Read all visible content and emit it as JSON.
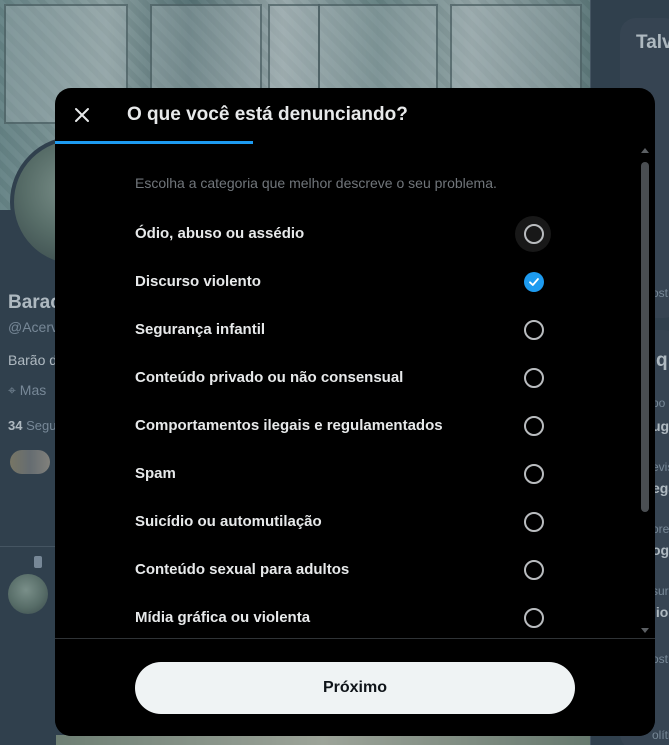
{
  "background": {
    "profile": {
      "name": "Barac",
      "handle": "@Acerv",
      "bio": "Barão d",
      "location": "Mas",
      "following_count": "34",
      "following_label": "Segu"
    },
    "sidebar": {
      "title": "Talv",
      "section_title": "q",
      "snippets": [
        {
          "text": "ost"
        },
        {
          "text": "po"
        },
        {
          "text": "ugg"
        },
        {
          "text": "evis"
        },
        {
          "text": "ega"
        },
        {
          "text": "orel"
        },
        {
          "text": "ogw"
        },
        {
          "text": "sur"
        },
        {
          "text": "lio"
        },
        {
          "text": "ost"
        },
        {
          "text": "olític"
        }
      ]
    }
  },
  "modal": {
    "title": "O que você está denunciando?",
    "subtitle": "Escolha a categoria que melhor descreve o seu problema.",
    "step_progress": 0.33,
    "options": [
      {
        "label": "Ódio, abuso ou assédio",
        "selected": false,
        "hovered": true
      },
      {
        "label": "Discurso violento",
        "selected": true,
        "hovered": false
      },
      {
        "label": "Segurança infantil",
        "selected": false,
        "hovered": false
      },
      {
        "label": "Conteúdo privado ou não consensual",
        "selected": false,
        "hovered": false
      },
      {
        "label": "Comportamentos ilegais e regulamentados",
        "selected": false,
        "hovered": false
      },
      {
        "label": "Spam",
        "selected": false,
        "hovered": false
      },
      {
        "label": "Suicídio ou automutilação",
        "selected": false,
        "hovered": false
      },
      {
        "label": "Conteúdo sexual para adultos",
        "selected": false,
        "hovered": false
      },
      {
        "label": "Mídia gráfica ou violenta",
        "selected": false,
        "hovered": false
      }
    ],
    "next_button": "Próximo"
  },
  "colors": {
    "accent": "#1d9bf0",
    "modal_bg": "#000000",
    "page_bg": "#15202b"
  }
}
